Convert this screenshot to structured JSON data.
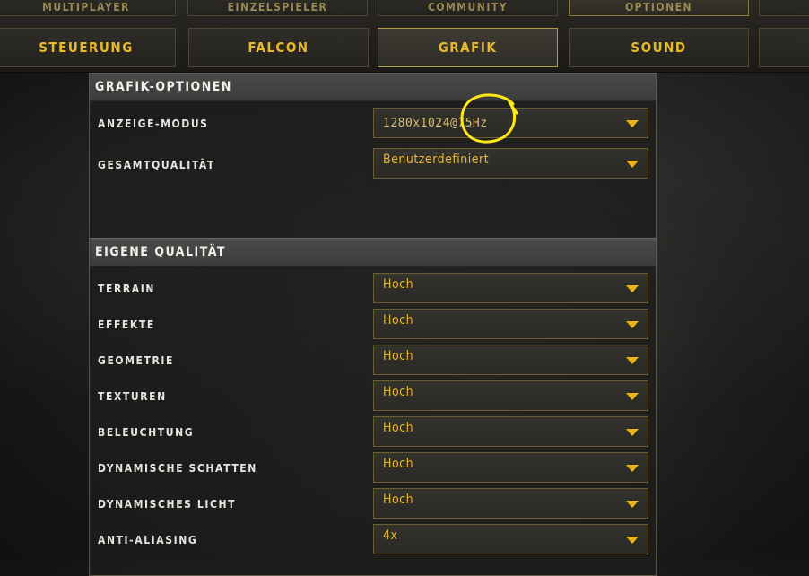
{
  "top_tabs": [
    {
      "label": "MULTIPLAYER"
    },
    {
      "label": "EINZELSPIELER"
    },
    {
      "label": "COMMUNITY"
    },
    {
      "label": "OPTIONEN"
    },
    {
      "label": ""
    }
  ],
  "sub_tabs": [
    {
      "label": "STEUERUNG"
    },
    {
      "label": "FALCON"
    },
    {
      "label": "GRAFIK"
    },
    {
      "label": "SOUND"
    },
    {
      "label": ""
    }
  ],
  "sections": {
    "graphics_options": "GRAFIK-OPTIONEN",
    "custom_quality": "EIGENE QUALITÄT"
  },
  "settings": [
    {
      "label": "ANZEIGE-MODUS",
      "value": "1280x1024@75Hz"
    },
    {
      "label": "GESAMTQUALITÄT",
      "value": "Benutzerdefiniert"
    },
    {
      "label": "TERRAIN",
      "value": "Hoch"
    },
    {
      "label": "EFFEKTE",
      "value": "Hoch"
    },
    {
      "label": "GEOMETRIE",
      "value": "Hoch"
    },
    {
      "label": "TEXTUREN",
      "value": "Hoch"
    },
    {
      "label": "BELEUCHTUNG",
      "value": "Hoch"
    },
    {
      "label": "DYNAMISCHE SCHATTEN",
      "value": "Hoch"
    },
    {
      "label": "DYNAMISCHES LICHT",
      "value": "Hoch"
    },
    {
      "label": "ANTI-ALIASING",
      "value": "4x"
    }
  ],
  "colors": {
    "accent": "#e8b92a",
    "caret": "#f0b21a",
    "annotation": "#ffe81a"
  },
  "icons": {
    "caret": "chevron-down-icon",
    "annotation": "highlight-circle-icon"
  }
}
